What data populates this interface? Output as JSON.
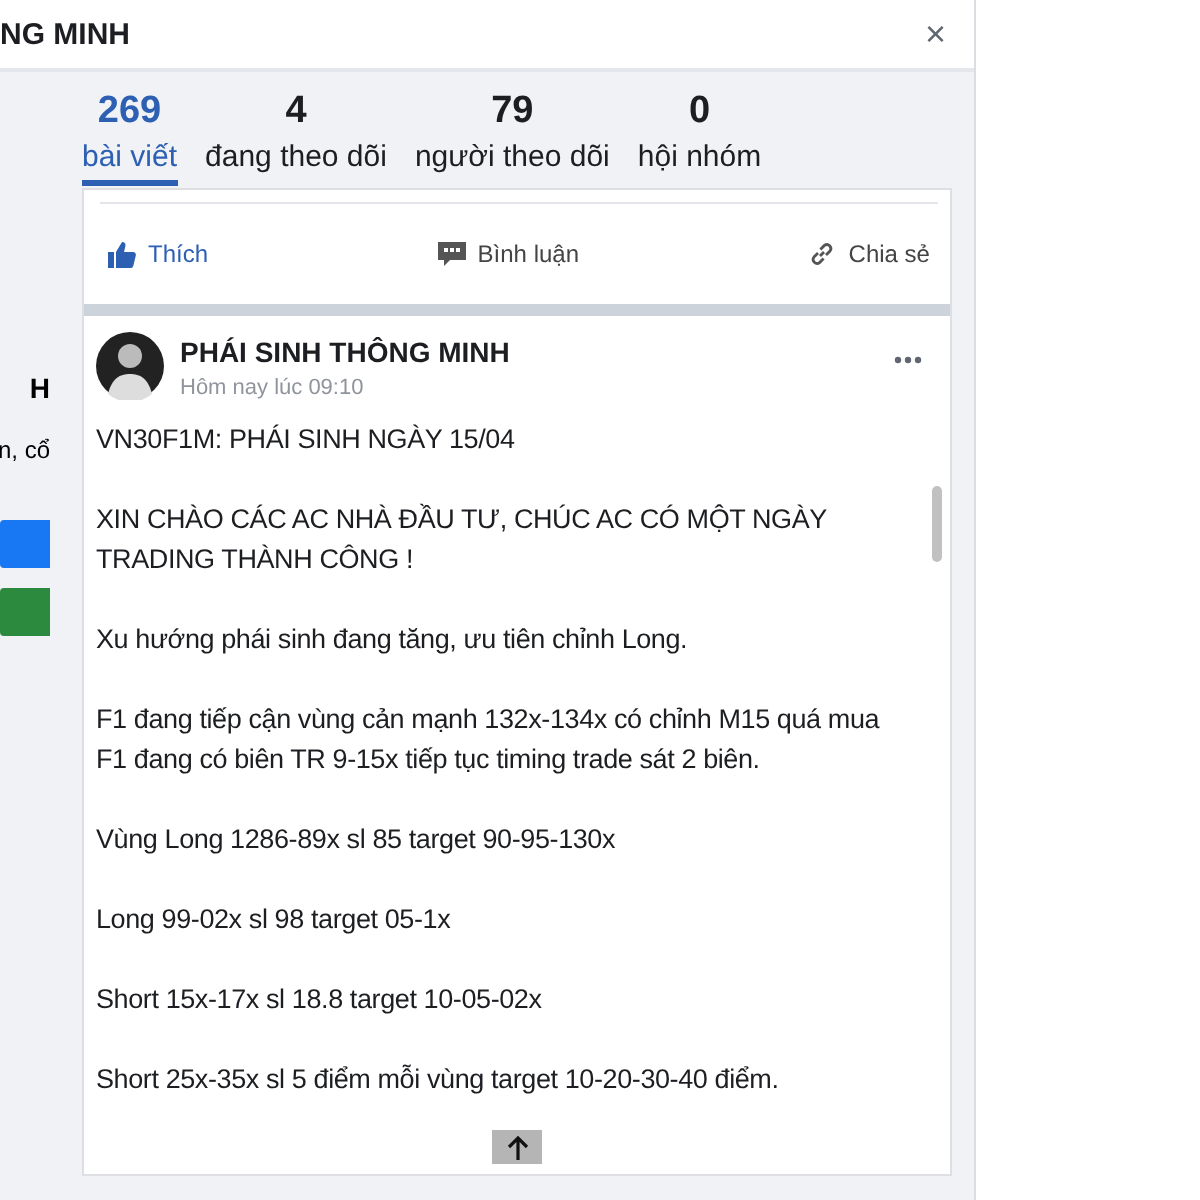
{
  "dialog": {
    "title": "NG MINH",
    "close": "×"
  },
  "side": {
    "heading": "H",
    "text": "n, cổ",
    "buttons": [
      {
        "kind": "primary"
      },
      {
        "kind": "success"
      }
    ]
  },
  "stats": [
    {
      "value": "269",
      "label": "bài viết",
      "selected": true
    },
    {
      "value": "4",
      "label": "đang theo dõi",
      "selected": false
    },
    {
      "value": "79",
      "label": "người theo dõi",
      "selected": false
    },
    {
      "value": "0",
      "label": "hội nhóm",
      "selected": false
    }
  ],
  "actions": [
    {
      "kind": "like",
      "label": "Thích"
    },
    {
      "kind": "comment",
      "label": "Bình luận"
    },
    {
      "kind": "share",
      "label": "Chia sẻ"
    }
  ],
  "post": {
    "author": "PHÁI SINH THÔNG MINH",
    "time": "Hôm nay lúc 09:10",
    "paragraphs": [
      "VN30F1M: PHÁI SINH NGÀY 15/04",
      "XIN CHÀO CÁC AC NHÀ ĐẦU TƯ, CHÚC AC CÓ MỘT NGÀY TRADING THÀNH CÔNG !",
      "Xu hướng phái sinh đang tăng, ưu tiên chỉnh Long.",
      "F1 đang tiếp cận vùng cản mạnh 132x-134x có chỉnh M15 quá mua\nF1 đang có biên TR 9-15x tiếp tục timing trade sát 2 biên.",
      "Vùng Long 1286-89x sl 85 target 90-95-130x",
      "Long 99-02x sl 98 target 05-1x",
      "Short 15x-17x sl 18.8 target 10-05-02x",
      "Short 25x-35x sl 5 điểm mỗi vùng target 10-20-30-40 điểm."
    ]
  }
}
